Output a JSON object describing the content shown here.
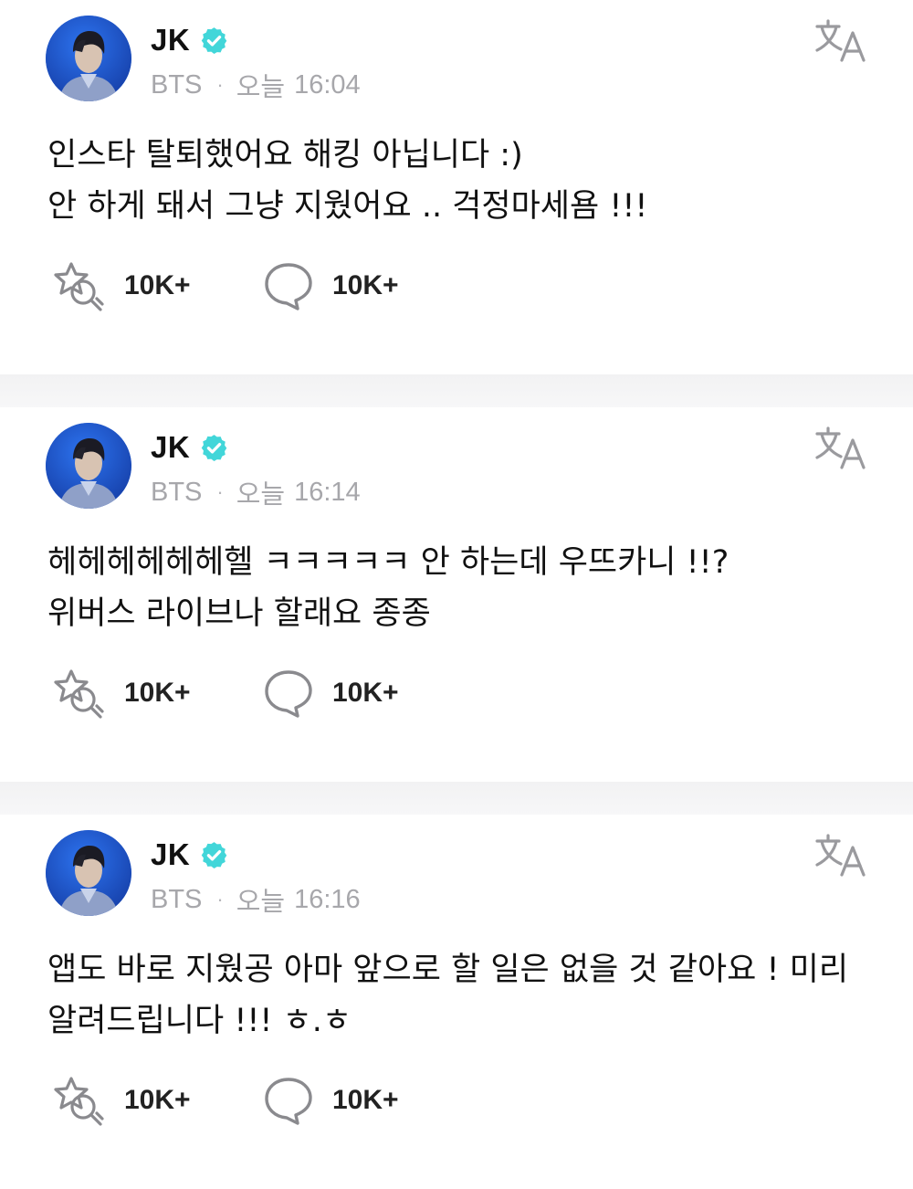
{
  "colors": {
    "accent": "#42D6D9",
    "meta_gray": "#A7A7AB",
    "icon_gray": "#8A8A8E",
    "avatar_bg": "#1E5CD4"
  },
  "icons": {
    "verified": "verified-badge-icon",
    "translate": "translate-icon",
    "reaction": "reaction-icon",
    "comment": "comment-icon"
  },
  "posts": [
    {
      "author": "JK",
      "group": "BTS",
      "time_label": "오늘",
      "time": "16:04",
      "text": "인스타 탈퇴했어요 해킹 아닙니다 :)\n안 하게 돼서 그냥 지웠어요 .. 걱정마세욤 !!!",
      "reactions": "10K+",
      "comments": "10K+"
    },
    {
      "author": "JK",
      "group": "BTS",
      "time_label": "오늘",
      "time": "16:14",
      "text": "헤헤헤헤헤헤헬 ㅋㅋㅋㅋㅋ 안 하는데 우뜨카니 !!?\n위버스 라이브나 할래요 종종",
      "reactions": "10K+",
      "comments": "10K+"
    },
    {
      "author": "JK",
      "group": "BTS",
      "time_label": "오늘",
      "time": "16:16",
      "text": "앱도 바로 지웠공 아마 앞으로 할 일은 없을 것 같아요 ! 미리\n알려드립니다 !!! ㅎ.ㅎ",
      "reactions": "10K+",
      "comments": "10K+"
    }
  ]
}
